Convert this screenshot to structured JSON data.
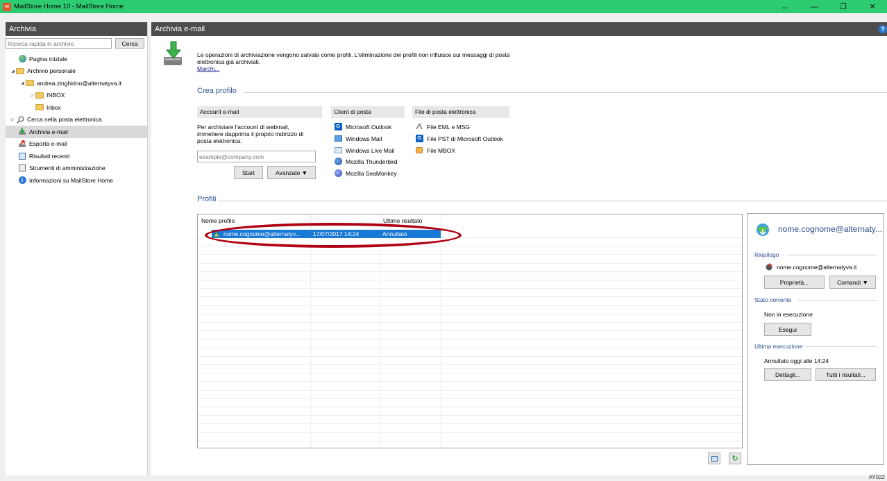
{
  "window": {
    "title": "MailStore Home 10 - MailStore Home",
    "controls": [
      "↔",
      "—",
      "❐",
      "✕"
    ]
  },
  "sidebar": {
    "header": "Archivia",
    "search_placeholder": "Ricerca rapida in archivio",
    "search_button": "Cerca",
    "items": [
      {
        "label": "Pagina iniziale"
      },
      {
        "label": "Archivio personale"
      },
      {
        "label": "andrea.zinghirino@alternatyva.it"
      },
      {
        "label": "INBOX"
      },
      {
        "label": "Inbox"
      },
      {
        "label": "Cerca nella posta elettronica"
      },
      {
        "label": "Archivia e-mail"
      },
      {
        "label": "Esporta e-mail"
      },
      {
        "label": "Risultati recenti"
      },
      {
        "label": "Strumenti di amministrazione"
      },
      {
        "label": "Informazioni su MailStore Home"
      }
    ]
  },
  "main": {
    "header": "Archivia e-mail",
    "help": "?",
    "intro_line1": "Le operazioni di archiviazione vengono salvate come profili. L'eliminazione dei profili non influisce sui messaggi di posta",
    "intro_line2": "elettronica già archiviati.",
    "intro_link": "Marchi...",
    "crea_profilo": "Crea profilo",
    "account_header": "Account e-mail",
    "account_desc_1": "Per archiviare l'account di webmail,",
    "account_desc_2": "immettere dapprima il proprio indirizzo di",
    "account_desc_3": "posta elettronica:",
    "email_placeholder": "example@company.com",
    "start_button": "Start",
    "advanced_button": "Avanzato ▼",
    "client_header": "Client di posta",
    "clients": [
      "Microsoft Outlook",
      "Windows Mail",
      "Windows Live Mail",
      "Mozilla Thunderbird",
      "Mozilla SeaMonkey"
    ],
    "files_header": "File di posta elettronica",
    "files": [
      "File EML e MSG",
      "File PST di Microsoft Outlook",
      "File MBOX"
    ],
    "profili": "Profili",
    "table": {
      "col_name": "Nome profilo",
      "col_result": "Ultimo risultato",
      "rows": [
        {
          "name": "nome.cognome@alternatyv...",
          "last_run": "17/07/2017 14:24",
          "result": "Annullato"
        }
      ]
    }
  },
  "panel": {
    "title": "nome.cognome@alternaty...",
    "riepilogo": "Riepilogo",
    "account": "nome.cognome@alternatyva.it",
    "properties_button": "Proprietà...",
    "commands_button": "Comandi ▼",
    "stato_corrente": "Stato corrente",
    "status": "Non in esecuzione",
    "run_button": "Esegui",
    "ultima_esecuzione": "Ultima esecuzione",
    "last_result": "Annullato oggi alle 14:24",
    "details_button": "Dettagli...",
    "all_results_button": "Tutti i risultati..."
  },
  "corner_code": "AY022",
  "colors": {
    "titlebar": "#2ecc71",
    "header": "#4d4d4d",
    "selection": "#1979d6",
    "highlight_oval": "#b00012"
  }
}
